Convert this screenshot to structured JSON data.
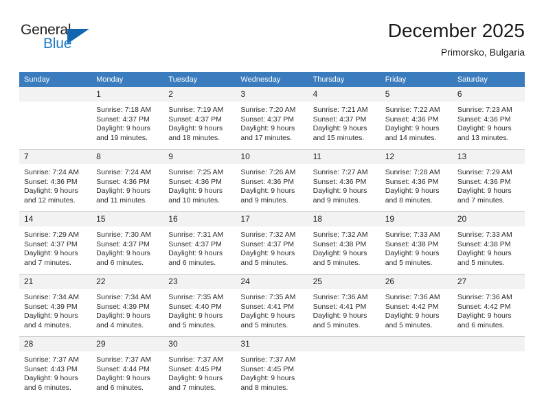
{
  "logo": {
    "word1": "General",
    "word2": "Blue",
    "triangle_icon": "triangle-icon",
    "color_dark": "#231f20",
    "color_blue": "#1f7ac4"
  },
  "header": {
    "title": "December 2025",
    "subtitle": "Primorsko, Bulgaria"
  },
  "theme": {
    "header_bg": "#3a7cbe",
    "header_text": "#ffffff",
    "daynum_bg": "#f2f2f2",
    "grid_line": "#c8c8c8",
    "body_text": "#2b2b2b"
  },
  "weekdays": [
    "Sunday",
    "Monday",
    "Tuesday",
    "Wednesday",
    "Thursday",
    "Friday",
    "Saturday"
  ],
  "weeks": [
    [
      {
        "day": "",
        "empty": true,
        "sunrise": "",
        "sunset": "",
        "daylight1": "",
        "daylight2": ""
      },
      {
        "day": "1",
        "sunrise": "Sunrise: 7:18 AM",
        "sunset": "Sunset: 4:37 PM",
        "daylight1": "Daylight: 9 hours",
        "daylight2": "and 19 minutes."
      },
      {
        "day": "2",
        "sunrise": "Sunrise: 7:19 AM",
        "sunset": "Sunset: 4:37 PM",
        "daylight1": "Daylight: 9 hours",
        "daylight2": "and 18 minutes."
      },
      {
        "day": "3",
        "sunrise": "Sunrise: 7:20 AM",
        "sunset": "Sunset: 4:37 PM",
        "daylight1": "Daylight: 9 hours",
        "daylight2": "and 17 minutes."
      },
      {
        "day": "4",
        "sunrise": "Sunrise: 7:21 AM",
        "sunset": "Sunset: 4:37 PM",
        "daylight1": "Daylight: 9 hours",
        "daylight2": "and 15 minutes."
      },
      {
        "day": "5",
        "sunrise": "Sunrise: 7:22 AM",
        "sunset": "Sunset: 4:36 PM",
        "daylight1": "Daylight: 9 hours",
        "daylight2": "and 14 minutes."
      },
      {
        "day": "6",
        "sunrise": "Sunrise: 7:23 AM",
        "sunset": "Sunset: 4:36 PM",
        "daylight1": "Daylight: 9 hours",
        "daylight2": "and 13 minutes."
      }
    ],
    [
      {
        "day": "7",
        "sunrise": "Sunrise: 7:24 AM",
        "sunset": "Sunset: 4:36 PM",
        "daylight1": "Daylight: 9 hours",
        "daylight2": "and 12 minutes."
      },
      {
        "day": "8",
        "sunrise": "Sunrise: 7:24 AM",
        "sunset": "Sunset: 4:36 PM",
        "daylight1": "Daylight: 9 hours",
        "daylight2": "and 11 minutes."
      },
      {
        "day": "9",
        "sunrise": "Sunrise: 7:25 AM",
        "sunset": "Sunset: 4:36 PM",
        "daylight1": "Daylight: 9 hours",
        "daylight2": "and 10 minutes."
      },
      {
        "day": "10",
        "sunrise": "Sunrise: 7:26 AM",
        "sunset": "Sunset: 4:36 PM",
        "daylight1": "Daylight: 9 hours",
        "daylight2": "and 9 minutes."
      },
      {
        "day": "11",
        "sunrise": "Sunrise: 7:27 AM",
        "sunset": "Sunset: 4:36 PM",
        "daylight1": "Daylight: 9 hours",
        "daylight2": "and 9 minutes."
      },
      {
        "day": "12",
        "sunrise": "Sunrise: 7:28 AM",
        "sunset": "Sunset: 4:36 PM",
        "daylight1": "Daylight: 9 hours",
        "daylight2": "and 8 minutes."
      },
      {
        "day": "13",
        "sunrise": "Sunrise: 7:29 AM",
        "sunset": "Sunset: 4:36 PM",
        "daylight1": "Daylight: 9 hours",
        "daylight2": "and 7 minutes."
      }
    ],
    [
      {
        "day": "14",
        "sunrise": "Sunrise: 7:29 AM",
        "sunset": "Sunset: 4:37 PM",
        "daylight1": "Daylight: 9 hours",
        "daylight2": "and 7 minutes."
      },
      {
        "day": "15",
        "sunrise": "Sunrise: 7:30 AM",
        "sunset": "Sunset: 4:37 PM",
        "daylight1": "Daylight: 9 hours",
        "daylight2": "and 6 minutes."
      },
      {
        "day": "16",
        "sunrise": "Sunrise: 7:31 AM",
        "sunset": "Sunset: 4:37 PM",
        "daylight1": "Daylight: 9 hours",
        "daylight2": "and 6 minutes."
      },
      {
        "day": "17",
        "sunrise": "Sunrise: 7:32 AM",
        "sunset": "Sunset: 4:37 PM",
        "daylight1": "Daylight: 9 hours",
        "daylight2": "and 5 minutes."
      },
      {
        "day": "18",
        "sunrise": "Sunrise: 7:32 AM",
        "sunset": "Sunset: 4:38 PM",
        "daylight1": "Daylight: 9 hours",
        "daylight2": "and 5 minutes."
      },
      {
        "day": "19",
        "sunrise": "Sunrise: 7:33 AM",
        "sunset": "Sunset: 4:38 PM",
        "daylight1": "Daylight: 9 hours",
        "daylight2": "and 5 minutes."
      },
      {
        "day": "20",
        "sunrise": "Sunrise: 7:33 AM",
        "sunset": "Sunset: 4:38 PM",
        "daylight1": "Daylight: 9 hours",
        "daylight2": "and 5 minutes."
      }
    ],
    [
      {
        "day": "21",
        "sunrise": "Sunrise: 7:34 AM",
        "sunset": "Sunset: 4:39 PM",
        "daylight1": "Daylight: 9 hours",
        "daylight2": "and 4 minutes."
      },
      {
        "day": "22",
        "sunrise": "Sunrise: 7:34 AM",
        "sunset": "Sunset: 4:39 PM",
        "daylight1": "Daylight: 9 hours",
        "daylight2": "and 4 minutes."
      },
      {
        "day": "23",
        "sunrise": "Sunrise: 7:35 AM",
        "sunset": "Sunset: 4:40 PM",
        "daylight1": "Daylight: 9 hours",
        "daylight2": "and 5 minutes."
      },
      {
        "day": "24",
        "sunrise": "Sunrise: 7:35 AM",
        "sunset": "Sunset: 4:41 PM",
        "daylight1": "Daylight: 9 hours",
        "daylight2": "and 5 minutes."
      },
      {
        "day": "25",
        "sunrise": "Sunrise: 7:36 AM",
        "sunset": "Sunset: 4:41 PM",
        "daylight1": "Daylight: 9 hours",
        "daylight2": "and 5 minutes."
      },
      {
        "day": "26",
        "sunrise": "Sunrise: 7:36 AM",
        "sunset": "Sunset: 4:42 PM",
        "daylight1": "Daylight: 9 hours",
        "daylight2": "and 5 minutes."
      },
      {
        "day": "27",
        "sunrise": "Sunrise: 7:36 AM",
        "sunset": "Sunset: 4:42 PM",
        "daylight1": "Daylight: 9 hours",
        "daylight2": "and 6 minutes."
      }
    ],
    [
      {
        "day": "28",
        "sunrise": "Sunrise: 7:37 AM",
        "sunset": "Sunset: 4:43 PM",
        "daylight1": "Daylight: 9 hours",
        "daylight2": "and 6 minutes."
      },
      {
        "day": "29",
        "sunrise": "Sunrise: 7:37 AM",
        "sunset": "Sunset: 4:44 PM",
        "daylight1": "Daylight: 9 hours",
        "daylight2": "and 6 minutes."
      },
      {
        "day": "30",
        "sunrise": "Sunrise: 7:37 AM",
        "sunset": "Sunset: 4:45 PM",
        "daylight1": "Daylight: 9 hours",
        "daylight2": "and 7 minutes."
      },
      {
        "day": "31",
        "sunrise": "Sunrise: 7:37 AM",
        "sunset": "Sunset: 4:45 PM",
        "daylight1": "Daylight: 9 hours",
        "daylight2": "and 8 minutes."
      },
      {
        "day": "",
        "empty": true,
        "sunrise": "",
        "sunset": "",
        "daylight1": "",
        "daylight2": ""
      },
      {
        "day": "",
        "empty": true,
        "sunrise": "",
        "sunset": "",
        "daylight1": "",
        "daylight2": ""
      },
      {
        "day": "",
        "empty": true,
        "sunrise": "",
        "sunset": "",
        "daylight1": "",
        "daylight2": ""
      }
    ]
  ]
}
